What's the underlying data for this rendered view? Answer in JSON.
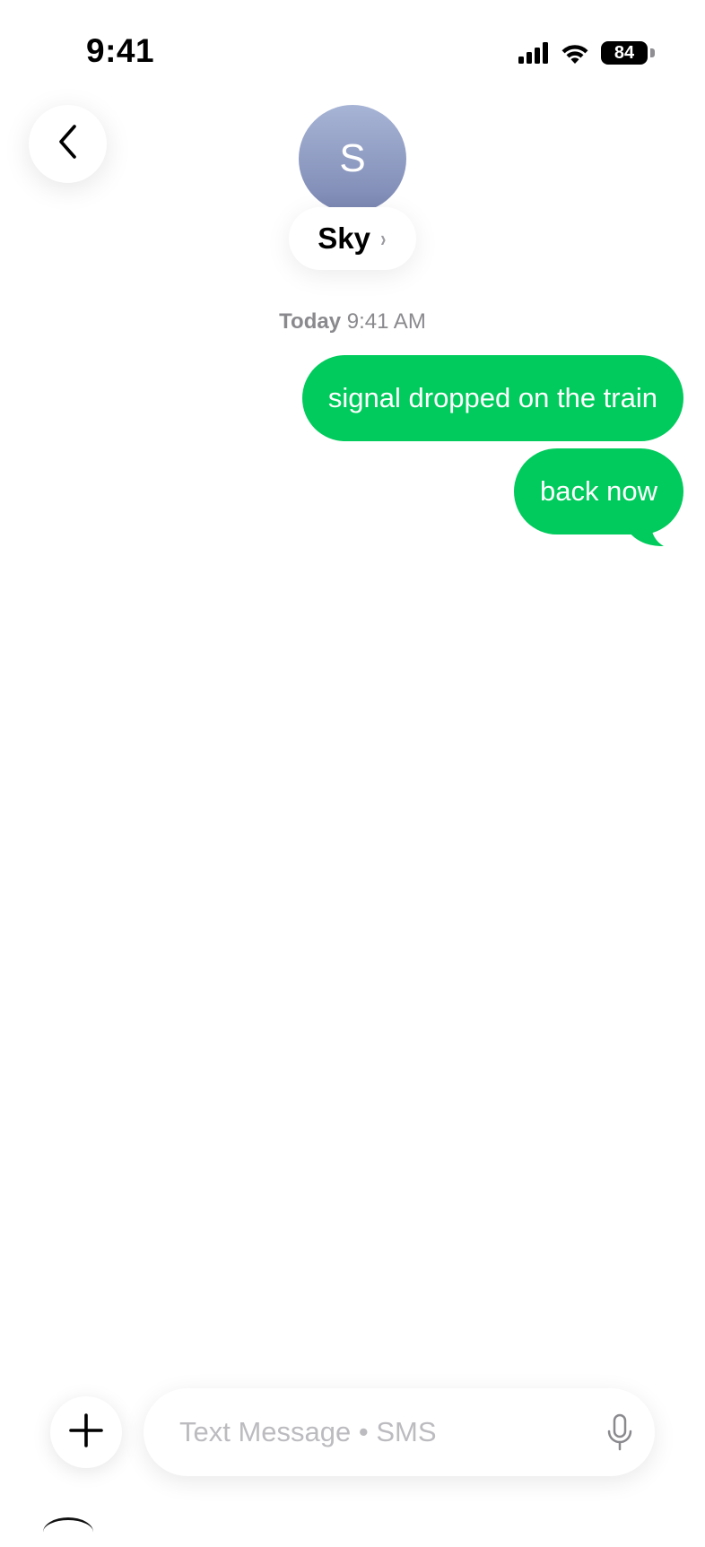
{
  "status_bar": {
    "time": "9:41",
    "battery_level": "84",
    "icons": [
      "signal-bars-icon",
      "wifi-icon",
      "battery-icon"
    ]
  },
  "header": {
    "back_icon": "chevron-left-icon",
    "avatar_initial": "S",
    "contact_name": "Sky",
    "contact_chevron": "›",
    "avatar_gradient": [
      "#a7b4d5",
      "#7b87b2"
    ]
  },
  "conversation": {
    "timestamp_day": "Today",
    "timestamp_time": "9:41 AM",
    "messages": [
      {
        "text": "signal dropped on the train",
        "direction": "outgoing"
      },
      {
        "text": "back now",
        "direction": "outgoing"
      }
    ],
    "bubble_color": "#00cb5c"
  },
  "composer": {
    "add_icon": "plus-icon",
    "placeholder": "Text Message • SMS",
    "mic_icon": "microphone-icon"
  }
}
